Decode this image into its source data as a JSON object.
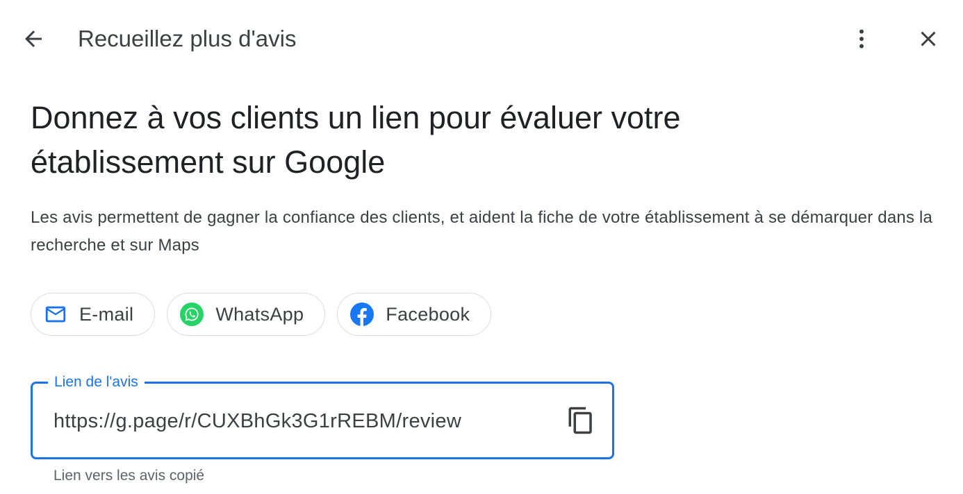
{
  "header": {
    "title": "Recueillez plus d'avis",
    "back_icon": "arrow-back-icon",
    "more_icon": "more-vert-icon",
    "close_icon": "close-icon"
  },
  "main": {
    "headline_line1": "Donnez à vos clients un lien pour évaluer votre",
    "headline_line2": "établissement sur Google",
    "description": "Les avis permettent de gagner la confiance des clients, et aident la fiche de votre établissement à se démarquer dans la recherche et sur Maps"
  },
  "share_chips": [
    {
      "label": "E-mail",
      "icon": "mail-icon",
      "color": "#1a73e8"
    },
    {
      "label": "WhatsApp",
      "icon": "whatsapp-icon",
      "color": "#25d366"
    },
    {
      "label": "Facebook",
      "icon": "facebook-icon",
      "color": "#1877f2"
    }
  ],
  "review_link": {
    "label": "Lien de l'avis",
    "value": "https://g.page/r/CUXBhGk3G1rREBM/review",
    "copy_icon": "copy-icon",
    "helper_text": "Lien vers les avis copié"
  },
  "colors": {
    "accent": "#1a73e8",
    "text_primary": "#202124",
    "text_secondary": "#3c4043",
    "border": "#dadce0"
  }
}
